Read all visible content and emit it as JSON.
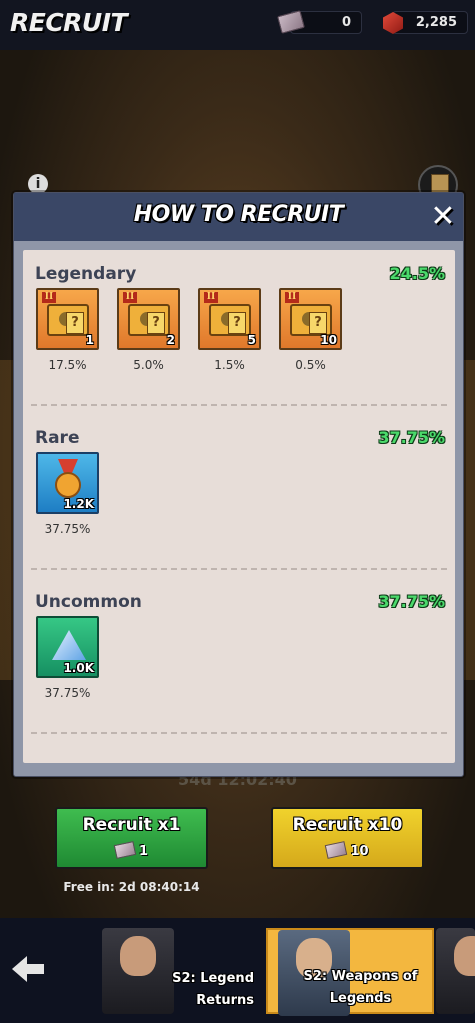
{
  "header": {
    "title": "RECRUIT",
    "tickets": "0",
    "gems": "2,285"
  },
  "modal": {
    "title": "HOW TO RECRUIT",
    "close_icon": "close-icon",
    "sections": [
      {
        "name": "Legendary",
        "percent": "24.5%",
        "items": [
          {
            "tier": "II",
            "qty": "1",
            "percent": "17.5%"
          },
          {
            "tier": "II",
            "qty": "2",
            "percent": "5.0%"
          },
          {
            "tier": "II",
            "qty": "5",
            "percent": "1.5%"
          },
          {
            "tier": "II",
            "qty": "10",
            "percent": "0.5%"
          }
        ]
      },
      {
        "name": "Rare",
        "percent": "37.75%",
        "items": [
          {
            "qty": "1.2K",
            "percent": "37.75%"
          }
        ]
      },
      {
        "name": "Uncommon",
        "percent": "37.75%",
        "items": [
          {
            "qty": "1.0K",
            "percent": "37.75%"
          }
        ]
      }
    ]
  },
  "background": {
    "timer": "54d 12:02:40"
  },
  "actions": {
    "recruit_x1": {
      "label": "Recruit x1",
      "cost": "1"
    },
    "recruit_x10": {
      "label": "Recruit x10",
      "cost": "10"
    },
    "free_in": "Free in: 2d 08:40:14"
  },
  "banners": [
    {
      "label_line1": "S2: Legend",
      "label_line2": "Returns"
    },
    {
      "label_line1": "S2: Weapons of",
      "label_line2": "Legends"
    }
  ],
  "colors": {
    "percent_green": "#4bd96b",
    "green_button": "#2fa843",
    "yellow_button": "#e6bf22",
    "header_bg": "#3a4766"
  }
}
